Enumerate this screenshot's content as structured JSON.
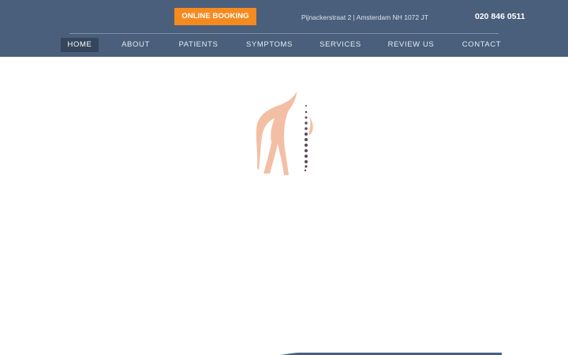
{
  "header": {
    "booking_label": "ONLINE BOOKING",
    "address": "Pijnackerstraat 2 | Amsterdam NH 1072 JT",
    "phone": "020 846 0511"
  },
  "nav": {
    "items": [
      {
        "label": "HOME",
        "active": true
      },
      {
        "label": "ABOUT"
      },
      {
        "label": "PATIENTS"
      },
      {
        "label": "SYMPTOMS"
      },
      {
        "label": "SERVICES"
      },
      {
        "label": "REVIEW US"
      },
      {
        "label": "CONTACT"
      }
    ]
  },
  "colors": {
    "header_bg": "#4a5f7b",
    "accent": "#f58a1f",
    "nav_active_bg": "#35465c",
    "logo_body": "#f2b89a",
    "logo_spine": "#5a4a57"
  },
  "hero": {
    "logo_icon": "spine-back-logo-icon"
  }
}
